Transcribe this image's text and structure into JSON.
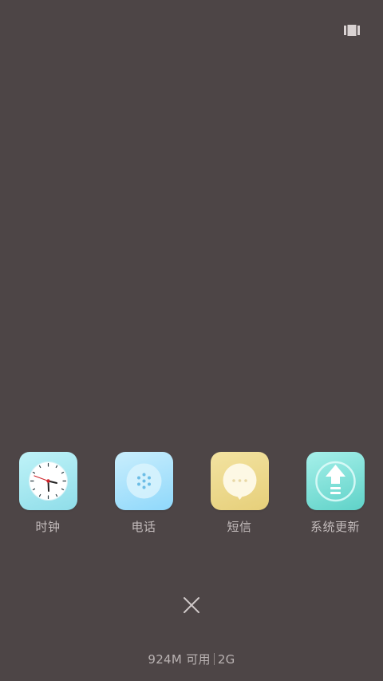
{
  "apps": [
    {
      "name": "clock",
      "label": "时钟",
      "icon": "clock-icon"
    },
    {
      "name": "phone",
      "label": "电话",
      "icon": "phone-dialpad-icon"
    },
    {
      "name": "sms",
      "label": "短信",
      "icon": "chat-bubble-icon"
    },
    {
      "name": "update",
      "label": "系统更新",
      "icon": "upload-arrow-icon"
    }
  ],
  "memory": {
    "available": "924M 可用",
    "total": "2G"
  },
  "colors": {
    "background": "#4d4546",
    "text": "#c3bcbc"
  }
}
